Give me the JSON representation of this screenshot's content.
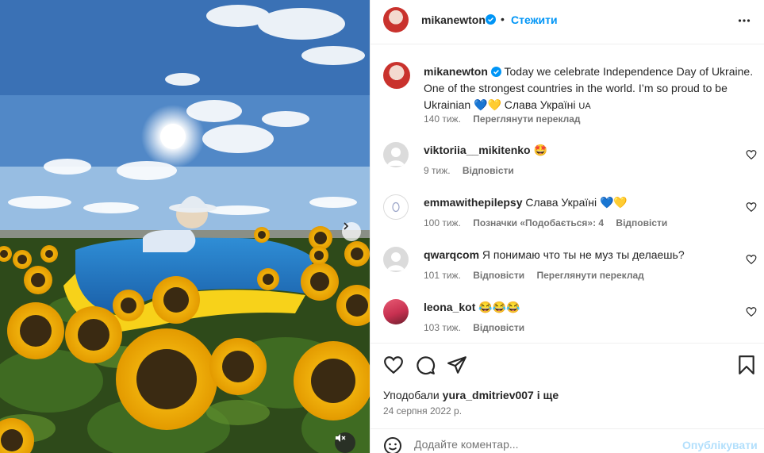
{
  "post": {
    "author": "mikanewton",
    "dot": "•",
    "follow_label": "Стежити",
    "caption_line1": "Today we celebrate Independence Day of Ukraine.",
    "caption_line2": "One of the strongest countries in the world. I’m so proud to be",
    "caption_line3_prefix": "Ukrainian 💙💛 Слава Україні",
    "caption_flag": "UA",
    "caption_time": "140 тиж.",
    "caption_translate": "Переглянути переклад"
  },
  "comments": [
    {
      "user": "viktoriia__mikitenko",
      "text": "🤩",
      "time": "9 тиж.",
      "likes": "",
      "reply": "Відповісти",
      "translate": ""
    },
    {
      "user": "emmawithepilepsy",
      "text": "Слава Україні 💙💛",
      "time": "100 тиж.",
      "likes": "Позначки «Подобається»: 4",
      "reply": "Відповісти",
      "translate": ""
    },
    {
      "user": "qwarqcom",
      "text": "Я понимаю что ты не муз ты делаешь?",
      "time": "101 тиж.",
      "likes": "",
      "reply": "Відповісти",
      "translate": "Переглянути переклад"
    },
    {
      "user": "leona_kot",
      "text": "😂😂😂",
      "time": "103 тиж.",
      "likes": "",
      "reply": "Відповісти",
      "translate": ""
    }
  ],
  "likes": {
    "prefix": "Уподобали",
    "user": "yura_dmitriev007",
    "suffix": "і ще"
  },
  "date": "24 серпня 2022 р.",
  "add_comment": {
    "placeholder": "Додайте коментар...",
    "publish_label": "Опублікувати"
  },
  "icons": {
    "verified": "verified-badge-icon",
    "more": "more-options-icon",
    "like": "heart-icon",
    "comment": "comment-icon",
    "share": "send-icon",
    "save": "bookmark-icon",
    "emoji": "emoji-icon",
    "next": "chevron-right-icon",
    "mute": "speaker-muted-icon"
  },
  "colors": {
    "accent": "#0095f6",
    "text": "#262626",
    "muted": "#737373",
    "publish_disabled": "#b2dffc"
  }
}
